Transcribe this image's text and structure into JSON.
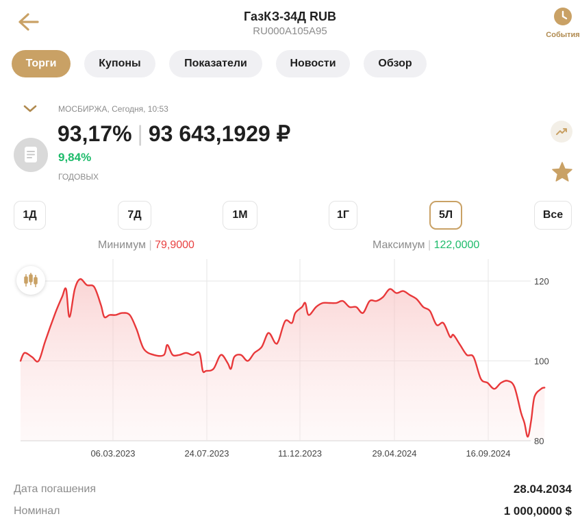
{
  "header": {
    "title": "ГазКЗ-34Д RUB",
    "isin": "RU000A105A95",
    "events_label": "События"
  },
  "icons": [
    "back-arrow-icon",
    "clock-icon",
    "chevron-down-icon",
    "document-icon",
    "trend-icon",
    "star-icon",
    "candlestick-icon"
  ],
  "colors": {
    "accent": "#c9a165",
    "up": "#1dbb6a",
    "down": "#e84040",
    "line": "#e8383a"
  },
  "tabs": [
    {
      "label": "Торги",
      "active": true
    },
    {
      "label": "Купоны",
      "active": false
    },
    {
      "label": "Показатели",
      "active": false
    },
    {
      "label": "Новости",
      "active": false
    },
    {
      "label": "Обзор",
      "active": false
    }
  ],
  "quote": {
    "exchange_line": "МОСБИРЖА, Сегодня, 10:53",
    "price_percent": "93,17%",
    "price_rub": "93 643,1929 ₽",
    "yield": "9,84%",
    "yield_label": "ГОДОВЫХ"
  },
  "periods": [
    {
      "label": "1Д",
      "active": false
    },
    {
      "label": "7Д",
      "active": false
    },
    {
      "label": "1М",
      "active": false
    },
    {
      "label": "1Г",
      "active": false
    },
    {
      "label": "5Л",
      "active": true
    },
    {
      "label": "Все",
      "active": false
    }
  ],
  "range": {
    "min_label": "Минимум",
    "min_value": "79,9000",
    "max_label": "Максимум",
    "max_value": "122,0000"
  },
  "chart_data": {
    "type": "area",
    "x_ticks": [
      "06.03.2023",
      "24.07.2023",
      "11.12.2023",
      "29.04.2024",
      "16.09.2024"
    ],
    "y_ticks": [
      80,
      100,
      120
    ],
    "ylim": [
      80,
      125
    ],
    "grid": true,
    "points": [
      [
        "2022-10-15",
        100.0
      ],
      [
        "2022-10-25",
        102.0
      ],
      [
        "2022-11-05",
        101.0
      ],
      [
        "2022-11-15",
        100.0
      ],
      [
        "2022-11-25",
        105.0
      ],
      [
        "2022-12-10",
        112.0
      ],
      [
        "2022-12-20",
        116.0
      ],
      [
        "2022-12-26",
        118.0
      ],
      [
        "2022-12-31",
        111.0
      ],
      [
        "2023-01-08",
        118.0
      ],
      [
        "2023-01-16",
        120.5
      ],
      [
        "2023-01-26",
        119.0
      ],
      [
        "2023-02-06",
        118.5
      ],
      [
        "2023-02-16",
        114.0
      ],
      [
        "2023-02-21",
        111.0
      ],
      [
        "2023-03-01",
        111.5
      ],
      [
        "2023-03-10",
        111.5
      ],
      [
        "2023-03-20",
        112.0
      ],
      [
        "2023-03-31",
        111.5
      ],
      [
        "2023-04-10",
        108.0
      ],
      [
        "2023-04-21",
        103.0
      ],
      [
        "2023-05-06",
        101.5
      ],
      [
        "2023-05-21",
        101.5
      ],
      [
        "2023-05-26",
        104.0
      ],
      [
        "2023-06-03",
        101.5
      ],
      [
        "2023-06-13",
        101.5
      ],
      [
        "2023-06-23",
        102.0
      ],
      [
        "2023-07-03",
        101.5
      ],
      [
        "2023-07-13",
        102.0
      ],
      [
        "2023-07-18",
        97.5
      ],
      [
        "2023-07-23",
        97.5
      ],
      [
        "2023-08-03",
        98.0
      ],
      [
        "2023-08-14",
        101.5
      ],
      [
        "2023-08-24",
        99.5
      ],
      [
        "2023-08-29",
        98.0
      ],
      [
        "2023-09-03",
        101.0
      ],
      [
        "2023-09-13",
        101.5
      ],
      [
        "2023-09-23",
        100.0
      ],
      [
        "2023-10-03",
        102.0
      ],
      [
        "2023-10-14",
        103.5
      ],
      [
        "2023-10-24",
        107.0
      ],
      [
        "2023-11-03",
        104.5
      ],
      [
        "2023-11-08",
        105.0
      ],
      [
        "2023-11-18",
        110.0
      ],
      [
        "2023-11-28",
        109.5
      ],
      [
        "2023-12-03",
        112.0
      ],
      [
        "2023-12-13",
        113.5
      ],
      [
        "2023-12-18",
        114.5
      ],
      [
        "2023-12-23",
        111.5
      ],
      [
        "2024-01-03",
        113.5
      ],
      [
        "2024-01-13",
        114.5
      ],
      [
        "2024-01-23",
        114.5
      ],
      [
        "2024-02-02",
        114.5
      ],
      [
        "2024-02-12",
        115.0
      ],
      [
        "2024-02-22",
        113.5
      ],
      [
        "2024-03-03",
        113.5
      ],
      [
        "2024-03-13",
        112.0
      ],
      [
        "2024-03-23",
        115.0
      ],
      [
        "2024-04-02",
        115.0
      ],
      [
        "2024-04-12",
        116.0
      ],
      [
        "2024-04-22",
        118.0
      ],
      [
        "2024-05-02",
        117.0
      ],
      [
        "2024-05-12",
        117.5
      ],
      [
        "2024-05-22",
        116.5
      ],
      [
        "2024-06-01",
        115.5
      ],
      [
        "2024-06-11",
        113.5
      ],
      [
        "2024-06-21",
        112.5
      ],
      [
        "2024-07-01",
        109.0
      ],
      [
        "2024-07-11",
        109.5
      ],
      [
        "2024-07-21",
        106.0
      ],
      [
        "2024-07-26",
        106.5
      ],
      [
        "2024-08-05",
        104.0
      ],
      [
        "2024-08-15",
        101.5
      ],
      [
        "2024-08-25",
        101.0
      ],
      [
        "2024-09-05",
        95.5
      ],
      [
        "2024-09-15",
        94.5
      ],
      [
        "2024-09-25",
        93.0
      ],
      [
        "2024-10-05",
        94.5
      ],
      [
        "2024-10-15",
        95.0
      ],
      [
        "2024-10-25",
        93.5
      ],
      [
        "2024-11-04",
        87.0
      ],
      [
        "2024-11-09",
        84.5
      ],
      [
        "2024-11-14",
        81.0
      ],
      [
        "2024-11-19",
        85.0
      ],
      [
        "2024-11-24",
        91.0
      ],
      [
        "2024-12-04",
        93.0
      ],
      [
        "2024-12-09",
        93.3
      ]
    ]
  },
  "details": [
    {
      "label": "Дата погашения",
      "value": "28.04.2034"
    },
    {
      "label": "Номинал",
      "value": "1 000,0000 $"
    }
  ]
}
